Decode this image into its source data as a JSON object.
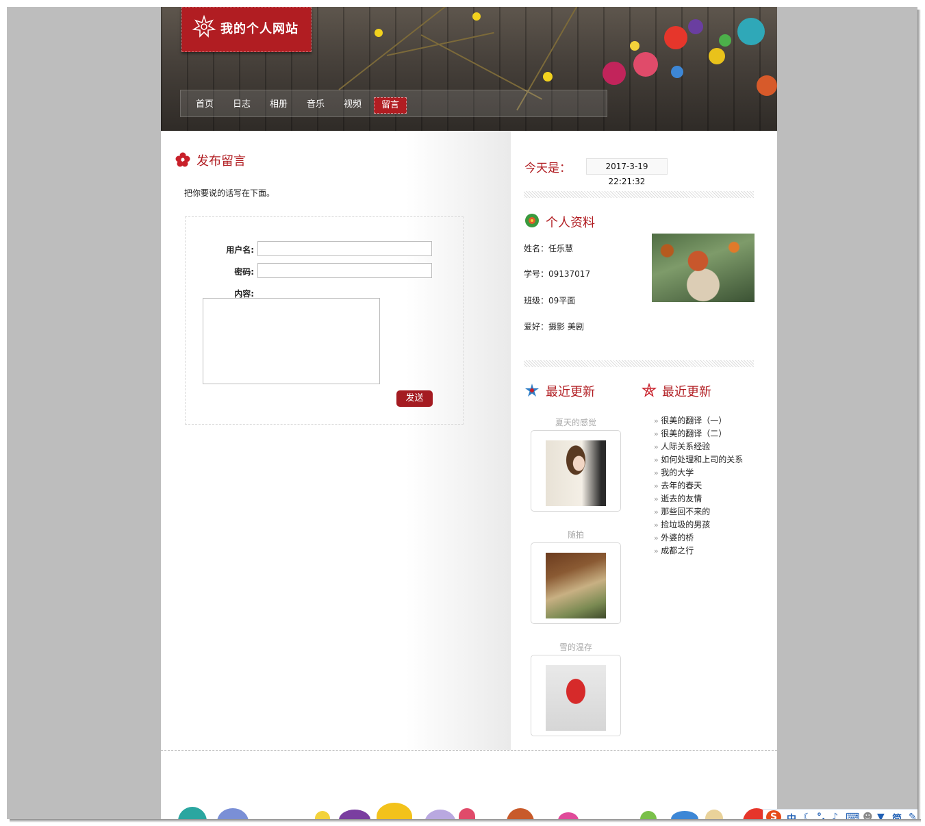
{
  "site": {
    "title": "我的个人网站"
  },
  "nav": {
    "items": [
      {
        "label": "首页",
        "active": false
      },
      {
        "label": "日志",
        "active": false
      },
      {
        "label": "相册",
        "active": false
      },
      {
        "label": "音乐",
        "active": false
      },
      {
        "label": "视频",
        "active": false
      },
      {
        "label": "留言",
        "active": true
      }
    ]
  },
  "message": {
    "title": "发布留言",
    "intro": "把你要说的话写在下面。",
    "username_label": "用户名:",
    "username_value": "",
    "password_label": "密码:",
    "password_value": "",
    "content_label": "内容:",
    "content_value": "",
    "send_label": "发送"
  },
  "sidebar": {
    "today_label": "今天是：",
    "today_value": "2017-3-19 22:21:32",
    "profile_title": "个人资料",
    "profile": {
      "name": "姓名：任乐慧",
      "student_id": "学号：09137017",
      "class": "班级：09平面",
      "hobby": "爱好：摄影 美剧"
    },
    "recent_photos_title": "最近更新",
    "recent_photos": [
      {
        "caption": "夏天的感觉"
      },
      {
        "caption": "随拍"
      },
      {
        "caption": "雪的温存"
      }
    ],
    "recent_posts_title": "最近更新",
    "recent_posts": [
      "很美的翻译（一）",
      "很美的翻译（二）",
      "人际关系经验",
      "如何处理和上司的关系",
      "我的大学",
      "去年的春天",
      "逝去的友情",
      "那些回不来的",
      "捡垃圾的男孩",
      "外婆的桥",
      "成都之行"
    ]
  },
  "ime_toolbar": {
    "logo": "S",
    "lang": "中",
    "items": [
      "moon-icon",
      "punctuation-icon",
      "mic-icon",
      "keyboard-icon",
      "user-icon",
      "skin-icon"
    ],
    "mode": "简",
    "tool": "wrench-icon"
  },
  "colors": {
    "accent": "#b11d22",
    "button": "#a41b21",
    "frame": "#bdbdbd"
  }
}
